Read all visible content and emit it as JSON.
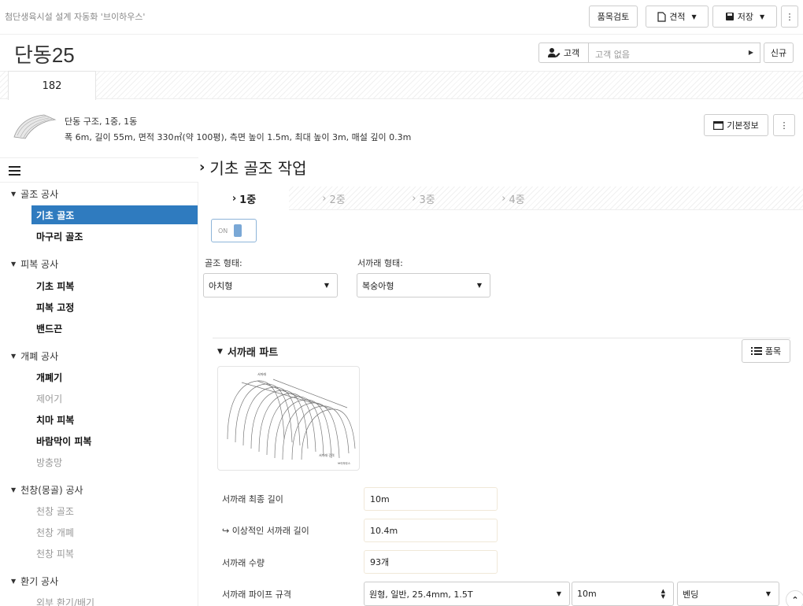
{
  "header": {
    "app_title": "첨단생육시설 설계 자동화 '브이하우스'",
    "review_label": "품목검토",
    "estimate_label": "견적",
    "save_label": "저장",
    "more_label": "⋮"
  },
  "project": {
    "title": "단동25",
    "customer_label": "고객",
    "customer_placeholder": "고객 없음",
    "new_label": "신규",
    "tab_label": "182"
  },
  "summary": {
    "line1": "단동 구조, 1중, 1동",
    "line2": "폭 6m, 길이 55m, 면적 330㎡(약 100평), 측면 높이 1.5m, 최대 높이 3m, 매설 깊이 0.3m",
    "basic_info_label": "기본정보"
  },
  "sidebar": {
    "groups": [
      {
        "label": "골조 공사",
        "items": [
          {
            "label": "기초 골조"
          },
          {
            "label": "마구리 골조"
          }
        ]
      },
      {
        "label": "피복 공사",
        "items": [
          {
            "label": "기초 피복"
          },
          {
            "label": "피복 고정"
          },
          {
            "label": "밴드끈"
          }
        ]
      },
      {
        "label": "개폐 공사",
        "items": [
          {
            "label": "개폐기"
          },
          {
            "label": "제어기"
          },
          {
            "label": "치마 피복"
          },
          {
            "label": "바람막이 피복"
          },
          {
            "label": "방충망"
          }
        ]
      },
      {
        "label": "천창(몽골) 공사",
        "items": [
          {
            "label": "천창 골조"
          },
          {
            "label": "천창 개폐"
          },
          {
            "label": "천창 피복"
          }
        ]
      },
      {
        "label": "환기 공사",
        "items": [
          {
            "label": "외부 환기/배기"
          }
        ]
      }
    ]
  },
  "main": {
    "section_title": "기초 골조 작업",
    "layer_tabs": [
      {
        "label": "1중"
      },
      {
        "label": "2중"
      },
      {
        "label": "3중"
      },
      {
        "label": "4중"
      }
    ],
    "toggle_label": "ON",
    "frame_type_label": "골조 형태:",
    "frame_type_value": "아치형",
    "rafter_type_label": "서까래 형태:",
    "rafter_type_value": "복숭아형",
    "part_title": "서까래 파트",
    "items_label": "품목",
    "image_caption_top": "서까래",
    "image_caption_bottom": "서까래 간격",
    "image_logo": "브이하우스",
    "fields": [
      {
        "label": "서까래 최종 길이",
        "value": "10m"
      },
      {
        "label": "↪ 이상적인 서까래 길이",
        "value": "10.4m"
      },
      {
        "label": "서까래 수량",
        "value": "93개"
      },
      {
        "label": "서까래 파이프 규격",
        "value": "원형, 일반, 25.4mm, 1.5T"
      }
    ],
    "pipe_length": "10m",
    "pipe_process": "벤딩"
  }
}
